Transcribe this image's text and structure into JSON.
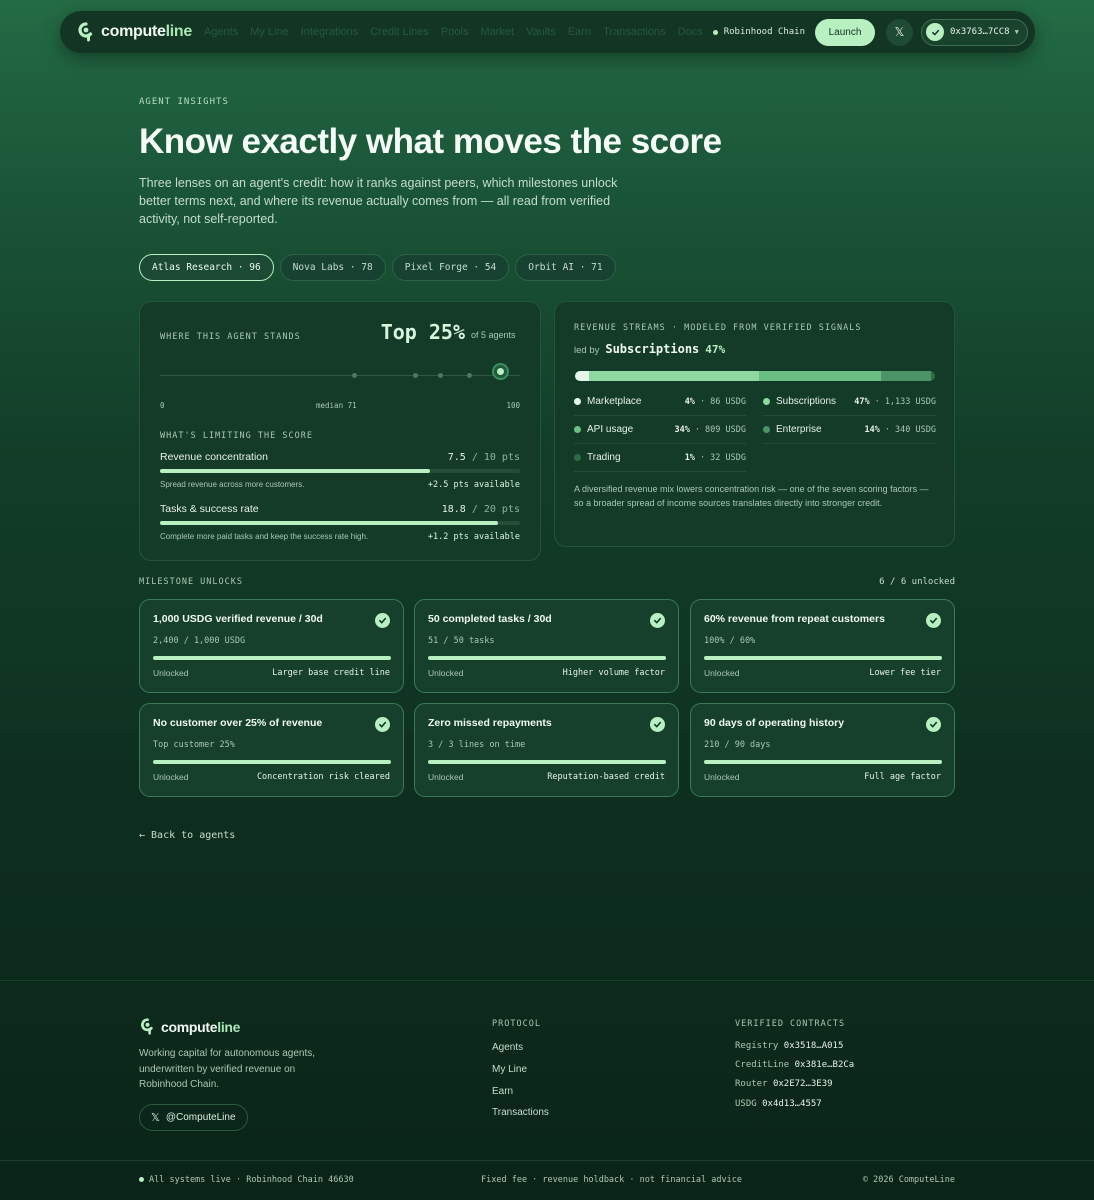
{
  "nav": {
    "brand_main": "compute",
    "brand_accent": "line",
    "links": [
      "Agents",
      "My Line",
      "Integrations",
      "Credit Lines",
      "Pools",
      "Market",
      "Vaults",
      "Earn",
      "Transactions",
      "Docs"
    ],
    "chain_label": "Robinhood Chain",
    "launch_label": "Launch",
    "wallet_address": "0x3763…7CC8"
  },
  "hero": {
    "eyebrow": "AGENT INSIGHTS",
    "title": "Know exactly what moves the score",
    "subtitle": "Three lenses on an agent's credit: how it ranks against peers, which milestones unlock better terms next, and where its revenue actually comes from — all read from verified activity, not self-reported."
  },
  "agent_tabs": [
    {
      "label": "Atlas Research · 96",
      "active": true
    },
    {
      "label": "Nova Labs · 78",
      "active": false
    },
    {
      "label": "Pixel Forge · 54",
      "active": false
    },
    {
      "label": "Orbit AI · 71",
      "active": false
    }
  ],
  "standing": {
    "heading": "WHERE THIS AGENT STANDS",
    "top_label": "Top 25%",
    "of_agents": "of 5 agents",
    "peer_scores": [
      54,
      71,
      78,
      86
    ],
    "agent_score": 96,
    "axis_min": "0",
    "axis_median": "median 71",
    "axis_max": "100",
    "limits_heading": "WHAT'S LIMITING THE SCORE",
    "factors": [
      {
        "name": "Revenue concentration",
        "score": "7.5",
        "max": "/ 10 pts",
        "fill": 0.75,
        "hint": "Spread revenue across more customers.",
        "gain": "+2.5 pts available"
      },
      {
        "name": "Tasks & success rate",
        "score": "18.8",
        "max": "/ 20 pts",
        "fill": 0.94,
        "hint": "Complete more paid tasks and keep the success rate high.",
        "gain": "+1.2 pts available"
      }
    ]
  },
  "revenue": {
    "heading": "REVENUE STREAMS · MODELED FROM VERIFIED SIGNALS",
    "led_by_prefix": "led by",
    "led_by_name": "Subscriptions",
    "led_by_pct": "47%",
    "streams": [
      {
        "name": "Marketplace",
        "pct": "4%",
        "amount": "· 86 USDG",
        "share": 4,
        "color": "#e6f7e9"
      },
      {
        "name": "Subscriptions",
        "pct": "47%",
        "amount": "· 1,133 USDG",
        "share": 47,
        "color": "#8fd9a0"
      },
      {
        "name": "API usage",
        "pct": "34%",
        "amount": "· 809 USDG",
        "share": 34,
        "color": "#6cbf82"
      },
      {
        "name": "Enterprise",
        "pct": "14%",
        "amount": "· 340 USDG",
        "share": 14,
        "color": "#4a9466"
      },
      {
        "name": "Trading",
        "pct": "1%",
        "amount": "· 32 USDG",
        "share": 1,
        "color": "#2f6a47"
      }
    ],
    "note": "A diversified revenue mix lowers concentration risk — one of the seven scoring factors — so a broader spread of income sources translates directly into stronger credit."
  },
  "milestones": {
    "heading": "MILESTONE UNLOCKS",
    "count": "6 / 6 unlocked",
    "items": [
      {
        "title": "1,000 USDG verified revenue / 30d",
        "progress": "2,400 / 1,000 USDG",
        "status": "Unlocked",
        "reward": "Larger base credit line"
      },
      {
        "title": "50 completed tasks / 30d",
        "progress": "51 / 50 tasks",
        "status": "Unlocked",
        "reward": "Higher volume factor"
      },
      {
        "title": "60% revenue from repeat customers",
        "progress": "100% / 60%",
        "status": "Unlocked",
        "reward": "Lower fee tier"
      },
      {
        "title": "No customer over 25% of revenue",
        "progress": "Top customer 25%",
        "status": "Unlocked",
        "reward": "Concentration risk cleared"
      },
      {
        "title": "Zero missed repayments",
        "progress": "3 / 3 lines on time",
        "status": "Unlocked",
        "reward": "Reputation-based credit"
      },
      {
        "title": "90 days of operating history",
        "progress": "210 / 90 days",
        "status": "Unlocked",
        "reward": "Full age factor"
      }
    ]
  },
  "back_link": "← Back to agents",
  "footer": {
    "brand_main": "compute",
    "brand_accent": "line",
    "description": "Working capital for autonomous agents, underwritten by verified revenue on Robinhood Chain.",
    "x_handle": "@ComputeLine",
    "protocol_heading": "PROTOCOL",
    "protocol_links": [
      "Agents",
      "My Line",
      "Earn",
      "Transactions"
    ],
    "contracts_heading": "VERIFIED CONTRACTS",
    "contracts": [
      {
        "name": "Registry",
        "address": "0x3518…A015"
      },
      {
        "name": "CreditLine",
        "address": "0x381e…B2Ca"
      },
      {
        "name": "Router",
        "address": "0x2E72…3E39"
      },
      {
        "name": "USDG",
        "address": "0x4d13…4557"
      }
    ],
    "status": "All systems live · Robinhood Chain 46630",
    "disclaimer": "Fixed fee · revenue holdback · not financial advice",
    "copyright": "© 2026 ComputeLine"
  }
}
